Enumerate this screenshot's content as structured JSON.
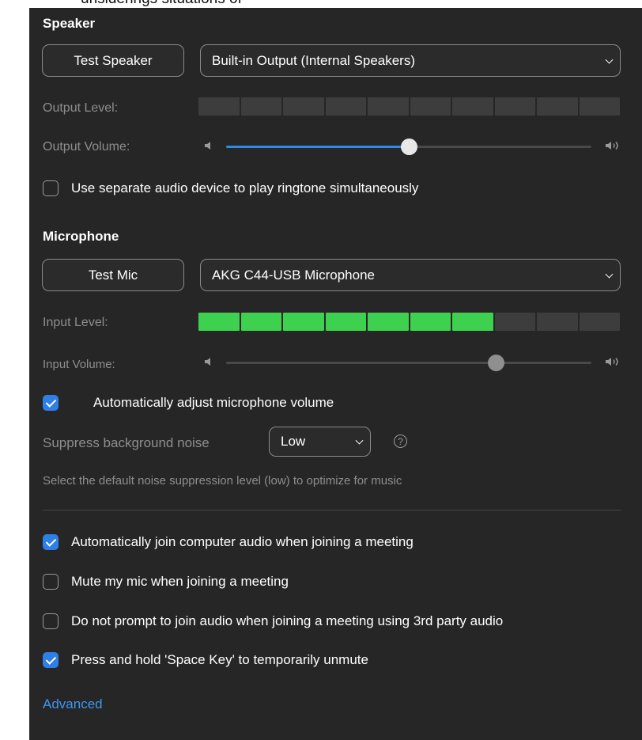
{
  "overlap_text": "unsiderings situations of",
  "speaker": {
    "title": "Speaker",
    "test_button": "Test Speaker",
    "device": "Built-in Output (Internal Speakers)",
    "output_level_label": "Output Level:",
    "output_level_segments_lit": 0,
    "output_level_segments_total": 10,
    "output_volume_label": "Output Volume:",
    "output_volume_fraction": 0.5,
    "ringtone_checkbox": {
      "label": "Use separate audio device to play ringtone simultaneously",
      "checked": false
    }
  },
  "microphone": {
    "title": "Microphone",
    "test_button": "Test Mic",
    "device": "AKG C44-USB Microphone",
    "input_level_label": "Input Level:",
    "input_level_segments_lit": 7,
    "input_level_segments_total": 10,
    "input_volume_label": "Input Volume:",
    "input_volume_fraction": 0.74,
    "auto_adjust_checkbox": {
      "label": "Automatically adjust microphone volume",
      "checked": true
    },
    "noise_label": "Suppress background noise",
    "noise_value": "Low",
    "noise_help": "?",
    "noise_hint": "Select the default noise suppression level (low) to optimize for music"
  },
  "options": [
    {
      "label": "Automatically join computer audio when joining a meeting",
      "checked": true
    },
    {
      "label": "Mute my mic when joining a meeting",
      "checked": false
    },
    {
      "label": "Do not prompt to join audio when joining a meeting using 3rd party audio",
      "checked": false
    },
    {
      "label": "Press and hold 'Space Key' to temporarily unmute",
      "checked": true
    }
  ],
  "advanced_link": "Advanced",
  "colors": {
    "accent": "#2e7fe6",
    "level_on": "#3ed14f",
    "link": "#3f97f0",
    "panel": "#262626"
  }
}
